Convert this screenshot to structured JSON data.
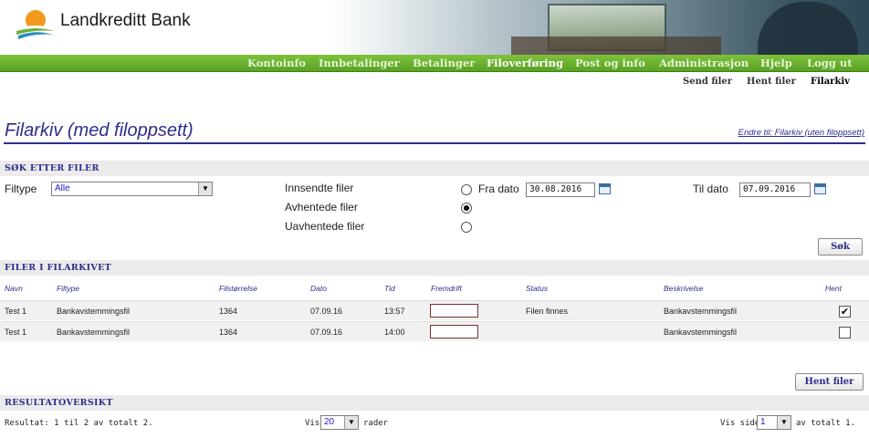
{
  "brand": {
    "name": "Landkreditt Bank"
  },
  "nav": {
    "items": [
      {
        "label": "Kontoinfo"
      },
      {
        "label": "Innbetalinger"
      },
      {
        "label": "Betalinger"
      },
      {
        "label": "Filoverføring",
        "active": true
      },
      {
        "label": "Post og info"
      },
      {
        "label": "Administrasjon"
      },
      {
        "label": "Hjelp"
      },
      {
        "label": "Logg ut"
      }
    ]
  },
  "subnav": {
    "items": [
      {
        "label": "Send filer"
      },
      {
        "label": "Hent filer"
      },
      {
        "label": "Filarkiv",
        "active": true
      }
    ]
  },
  "page": {
    "title": "Filarkiv (med filoppsett)",
    "change_link": "Endre til: Filarkiv (uten filoppsett)"
  },
  "search": {
    "header": "SØK ETTER FILER",
    "filetype_label": "Filtype",
    "filetype_value": "Alle",
    "radio_options": [
      {
        "label": "Innsendte filer",
        "checked": false
      },
      {
        "label": "Avhentede filer",
        "checked": true
      },
      {
        "label": "Uavhentede filer",
        "checked": false
      }
    ],
    "from_date_label": "Fra dato",
    "from_date_value": "30.08.2016",
    "to_date_label": "Til dato",
    "to_date_value": "07.09.2016",
    "search_button": "Søk"
  },
  "archive": {
    "header": "FILER I FILARKIVET",
    "columns": [
      "Navn",
      "Filtype",
      "Filstørrelse",
      "Dato",
      "Tid",
      "Fremdrift",
      "Status",
      "Beskrivelse",
      "Hent"
    ],
    "rows": [
      {
        "navn": "Test 1",
        "filtype": "Bankavstemmingsfil",
        "filstorrelse": "1364",
        "dato": "07.09.16",
        "tid": "13:57",
        "status": "Filen finnes",
        "beskrivelse": "Bankavstemmingsfil",
        "hent": true
      },
      {
        "navn": "Test 1",
        "filtype": "Bankavstemmingsfil",
        "filstorrelse": "1364",
        "dato": "07.09.16",
        "tid": "14:00",
        "status": "",
        "beskrivelse": "Bankavstemmingsfil",
        "hent": false
      }
    ],
    "fetch_button": "Hent filer"
  },
  "results": {
    "header": "RESULTATOVERSIKT",
    "summary": "Resultat: 1 til 2 av totalt 2.",
    "show_label": "Vis",
    "rows_per_page": "20",
    "rows_suffix": "rader",
    "page_label": "Vis side",
    "page_value": "1",
    "total_pages": "av totalt 1."
  },
  "colors": {
    "nav_green": "#5aa125",
    "title_blue": "#2d2d8c",
    "section_bg": "#ebebeb"
  }
}
